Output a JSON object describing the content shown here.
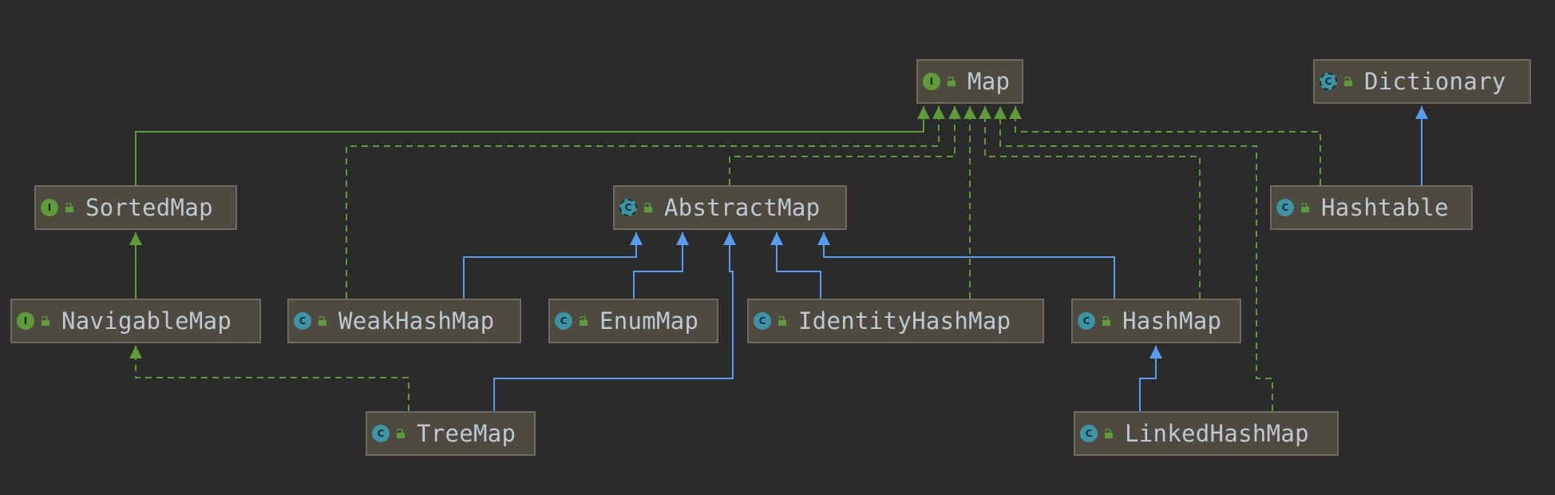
{
  "diagram": {
    "background": "#2b2b2b",
    "colors": {
      "implements_edge": "#5f9b3a",
      "extends_edge": "#5a9bf0",
      "node_fill": "#4e4a3f",
      "node_border": "#6d6a5f",
      "label_text": "#bfc9d4"
    },
    "nodes": {
      "map": {
        "label": "Map",
        "kind": "interface",
        "kind_letter": "I"
      },
      "dictionary": {
        "label": "Dictionary",
        "kind": "abstract",
        "kind_letter": "C"
      },
      "sorted_map": {
        "label": "SortedMap",
        "kind": "interface",
        "kind_letter": "I"
      },
      "abstract_map": {
        "label": "AbstractMap",
        "kind": "abstract",
        "kind_letter": "C"
      },
      "hashtable": {
        "label": "Hashtable",
        "kind": "class",
        "kind_letter": "C"
      },
      "navigable_map": {
        "label": "NavigableMap",
        "kind": "interface",
        "kind_letter": "I"
      },
      "weak_hash_map": {
        "label": "WeakHashMap",
        "kind": "class",
        "kind_letter": "C"
      },
      "enum_map": {
        "label": "EnumMap",
        "kind": "class",
        "kind_letter": "C"
      },
      "identity_hash_map": {
        "label": "IdentityHashMap",
        "kind": "class",
        "kind_letter": "C"
      },
      "hash_map": {
        "label": "HashMap",
        "kind": "class",
        "kind_letter": "C"
      },
      "tree_map": {
        "label": "TreeMap",
        "kind": "class",
        "kind_letter": "C"
      },
      "linked_hash_map": {
        "label": "LinkedHashMap",
        "kind": "class",
        "kind_letter": "C"
      }
    },
    "edges": [
      {
        "from": "sorted_map",
        "to": "map",
        "relation": "extends-interface"
      },
      {
        "from": "weak_hash_map",
        "to": "map",
        "relation": "implements"
      },
      {
        "from": "abstract_map",
        "to": "map",
        "relation": "implements"
      },
      {
        "from": "identity_hash_map",
        "to": "map",
        "relation": "implements"
      },
      {
        "from": "hash_map",
        "to": "map",
        "relation": "implements"
      },
      {
        "from": "linked_hash_map",
        "to": "map",
        "relation": "implements"
      },
      {
        "from": "hashtable",
        "to": "map",
        "relation": "implements"
      },
      {
        "from": "hashtable",
        "to": "dictionary",
        "relation": "extends"
      },
      {
        "from": "navigable_map",
        "to": "sorted_map",
        "relation": "extends-interface"
      },
      {
        "from": "tree_map",
        "to": "navigable_map",
        "relation": "implements"
      },
      {
        "from": "weak_hash_map",
        "to": "abstract_map",
        "relation": "extends"
      },
      {
        "from": "enum_map",
        "to": "abstract_map",
        "relation": "extends"
      },
      {
        "from": "tree_map",
        "to": "abstract_map",
        "relation": "extends"
      },
      {
        "from": "identity_hash_map",
        "to": "abstract_map",
        "relation": "extends"
      },
      {
        "from": "hash_map",
        "to": "abstract_map",
        "relation": "extends"
      },
      {
        "from": "linked_hash_map",
        "to": "hash_map",
        "relation": "extends"
      }
    ]
  }
}
